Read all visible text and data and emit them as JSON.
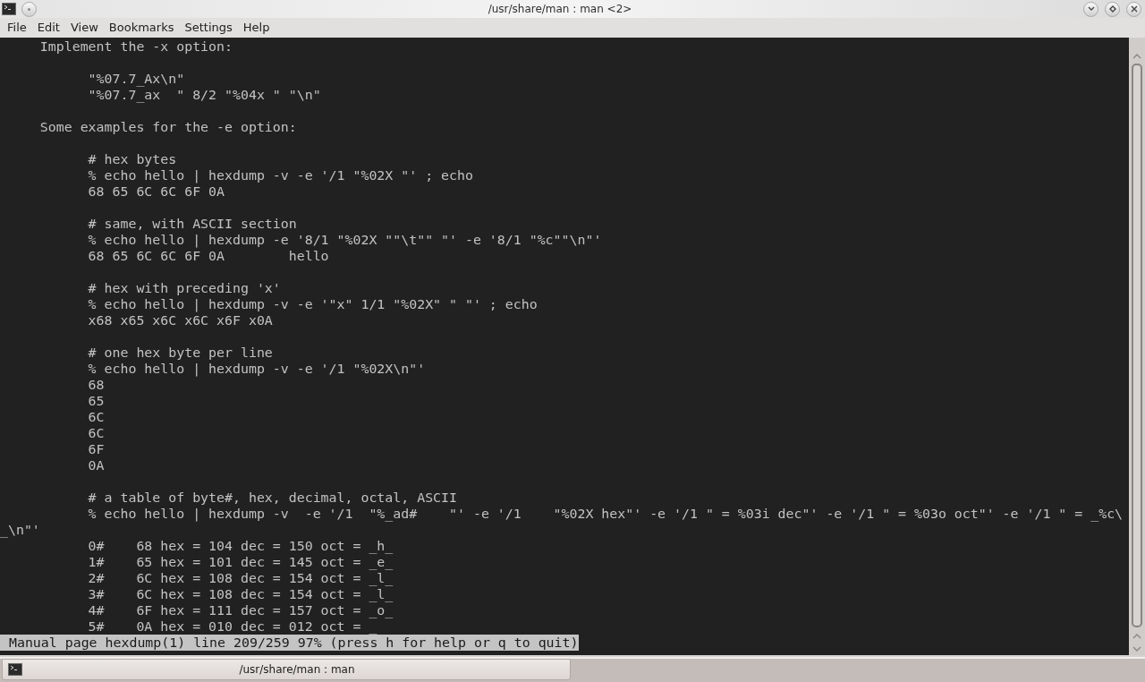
{
  "window": {
    "title": "/usr/share/man : man <2>"
  },
  "menu": [
    "File",
    "Edit",
    "View",
    "Bookmarks",
    "Settings",
    "Help"
  ],
  "terminal": {
    "blocks": [
      [
        "     Implement the -x option:"
      ],
      [
        "           \"%07.7_Ax\\n\"",
        "           \"%07.7_ax  \" 8/2 \"%04x \" \"\\n\""
      ],
      [
        "     Some examples for the -e option:"
      ],
      [
        "           # hex bytes",
        "           % echo hello | hexdump -v -e '/1 \"%02X \"' ; echo",
        "           68 65 6C 6C 6F 0A"
      ],
      [
        "           # same, with ASCII section",
        "           % echo hello | hexdump -e '8/1 \"%02X \"\"\\t\"\" \"' -e '8/1 \"%c\"\"\\n\"'",
        "           68 65 6C 6C 6F 0A        hello"
      ],
      [
        "           # hex with preceding 'x'",
        "           % echo hello | hexdump -v -e '\"x\" 1/1 \"%02X\" \" \"' ; echo",
        "           x68 x65 x6C x6C x6F x0A"
      ],
      [
        "           # one hex byte per line",
        "           % echo hello | hexdump -v -e '/1 \"%02X\\n\"'",
        "           68",
        "           65",
        "           6C",
        "           6C",
        "           6F",
        "           0A"
      ],
      [
        "           # a table of byte#, hex, decimal, octal, ASCII",
        "           % echo hello | hexdump -v  -e '/1  \"%_ad#    \"' -e '/1    \"%02X hex\"' -e '/1 \" = %03i dec\"' -e '/1 \" = %03o oct\"' -e '/1 \" = _%c\\",
        "_\\n\"'",
        "           0#    68 hex = 104 dec = 150 oct = _h_",
        "           1#    65 hex = 101 dec = 145 oct = _e_",
        "           2#    6C hex = 108 dec = 154 oct = _l_",
        "           3#    6C hex = 108 dec = 154 oct = _l_",
        "           4#    6F hex = 111 dec = 157 oct = _o_",
        "           5#    0A hex = 010 dec = 012 oct = _"
      ]
    ],
    "status": "Manual page hexdump(1) line 209/259 97% (press h for help or q to quit)"
  },
  "taskbar": {
    "tasks": [
      {
        "label": "/usr/share/man : man"
      }
    ]
  }
}
